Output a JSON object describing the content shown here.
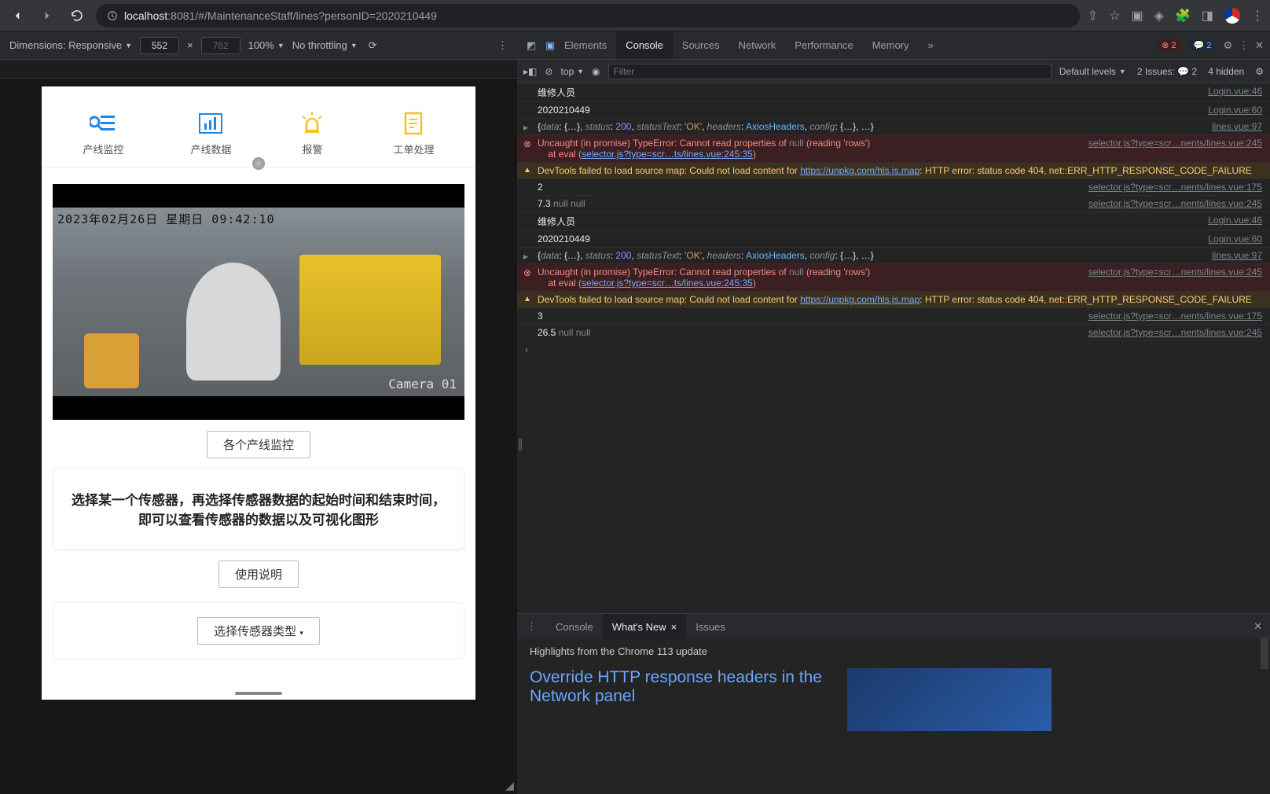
{
  "browser": {
    "url_prefix": "localhost",
    "url_rest": ":8081/#/MaintenanceStaff/lines?personID=2020210449"
  },
  "device_bar": {
    "dimensions_label": "Dimensions: Responsive",
    "width": "552",
    "height": "762",
    "sep": "×",
    "zoom": "100%",
    "throttle": "No throttling"
  },
  "app": {
    "nav": [
      {
        "label": "产线监控",
        "icon": "search-list",
        "color": "#1E88E5"
      },
      {
        "label": "产线数据",
        "icon": "bar-chart",
        "color": "#1E88E5"
      },
      {
        "label": "报警",
        "icon": "alarm",
        "color": "#F4C521"
      },
      {
        "label": "工单处理",
        "icon": "doc",
        "color": "#F4C521"
      }
    ],
    "video": {
      "timestamp": "2023年02月26日  星期日   09:42:10",
      "camera": "Camera 01"
    },
    "btn_monitor": "各个产线监控",
    "info_text": "选择某一个传感器，再选择传感器数据的起始时间和结束时间，即可以查看传感器的数据以及可视化图形",
    "btn_usage": "使用说明",
    "select_sensor": "选择传感器类型"
  },
  "devtools": {
    "tabs": [
      "Elements",
      "Console",
      "Sources",
      "Network",
      "Performance",
      "Memory"
    ],
    "more": "»",
    "err_badge": "2",
    "msg_badge": "2",
    "console_bar": {
      "context": "top",
      "filter_ph": "Filter",
      "levels": "Default levels",
      "issues": "2 Issues:",
      "issues_n": "2",
      "hidden": "4 hidden"
    },
    "logs": [
      {
        "t": "log",
        "msg": "维修人员",
        "src": "Login.vue:46"
      },
      {
        "t": "log",
        "msg": "2020210449",
        "src": "Login.vue:60"
      },
      {
        "t": "obj",
        "msg": "{data: {…}, status: 200, statusText: 'OK', headers: AxiosHeaders, config: {…}, …}",
        "src": "lines.vue:97"
      },
      {
        "t": "err",
        "msg": "Uncaught (in promise) TypeError: Cannot read properties of null (reading 'rows')\n    at eval (selector.js?type=scr…ts/lines.vue:245:35)",
        "src": "selector.js?type=scr…nents/lines.vue:245"
      },
      {
        "t": "warn",
        "msg": "DevTools failed to load source map: Could not load content for https://unpkg.com/hls.js.map: HTTP error: status code 404, net::ERR_HTTP_RESPONSE_CODE_FAILURE",
        "src": ""
      },
      {
        "t": "log",
        "msg": "2",
        "src": "selector.js?type=scr…nents/lines.vue:175"
      },
      {
        "t": "log",
        "msg": "7.3 null null",
        "src": "selector.js?type=scr…nents/lines.vue:245"
      },
      {
        "t": "log",
        "msg": "维修人员",
        "src": "Login.vue:46"
      },
      {
        "t": "log",
        "msg": "2020210449",
        "src": "Login.vue:60"
      },
      {
        "t": "obj",
        "msg": "{data: {…}, status: 200, statusText: 'OK', headers: AxiosHeaders, config: {…}, …}",
        "src": "lines.vue:97"
      },
      {
        "t": "err",
        "msg": "Uncaught (in promise) TypeError: Cannot read properties of null (reading 'rows')\n    at eval (selector.js?type=scr…ts/lines.vue:245:35)",
        "src": "selector.js?type=scr…nents/lines.vue:245"
      },
      {
        "t": "warn",
        "msg": "DevTools failed to load source map: Could not load content for https://unpkg.com/hls.js.map: HTTP error: status code 404, net::ERR_HTTP_RESPONSE_CODE_FAILURE",
        "src": ""
      },
      {
        "t": "log",
        "msg": "3",
        "src": "selector.js?type=scr…nents/lines.vue:175"
      },
      {
        "t": "log",
        "msg": "26.5 null null",
        "src": "selector.js?type=scr…nents/lines.vue:245"
      }
    ]
  },
  "drawer": {
    "tabs": [
      "Console",
      "What's New",
      "Issues"
    ],
    "highlight": "Highlights from the Chrome 113 update",
    "article_title": "Override HTTP response headers in the Network panel"
  }
}
